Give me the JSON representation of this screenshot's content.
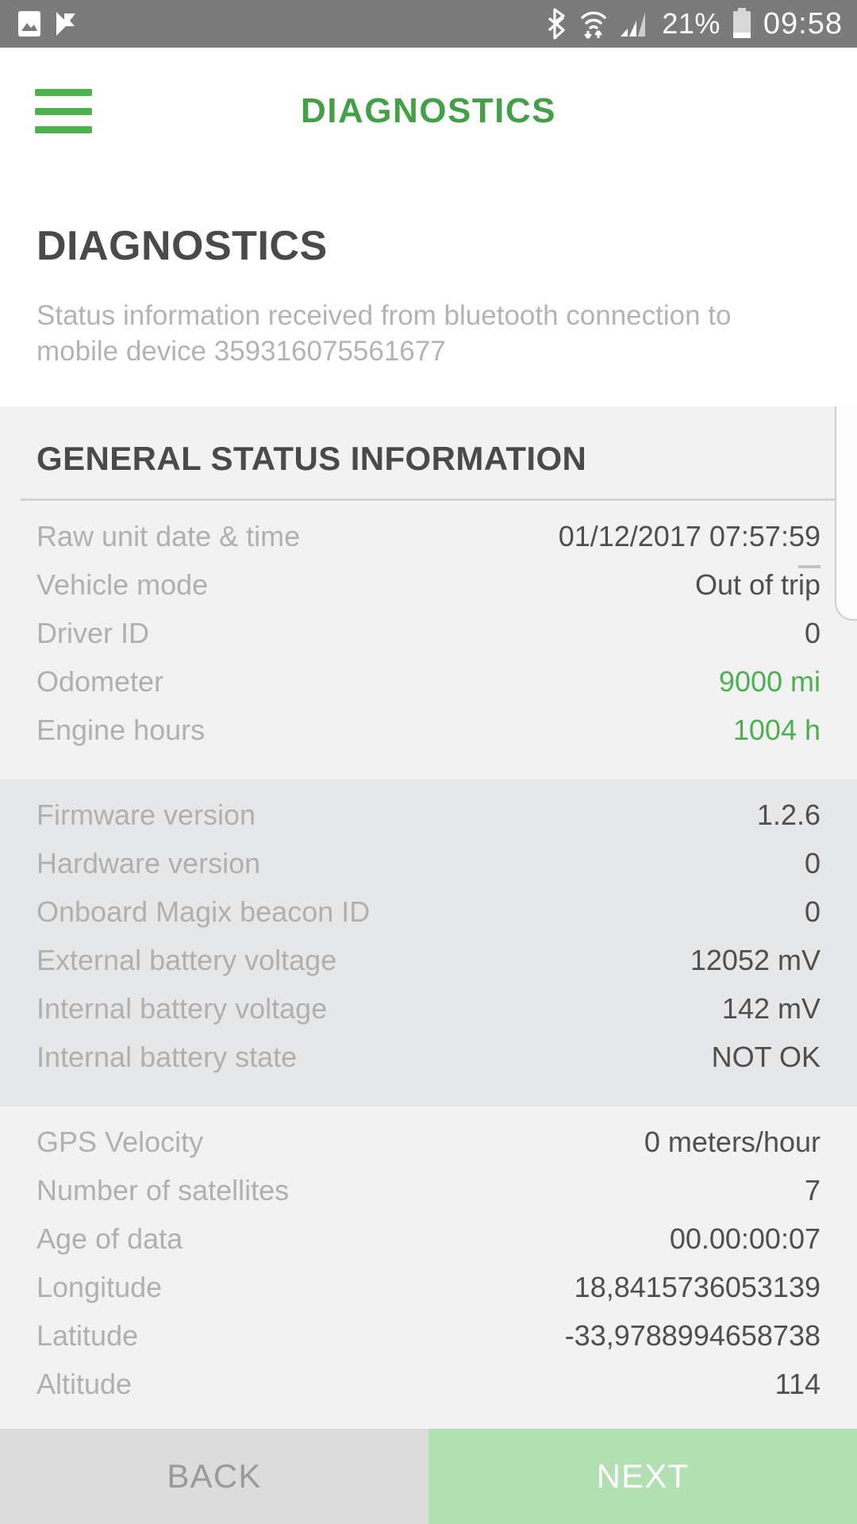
{
  "statusbar": {
    "left_icons": [
      "image-icon",
      "flag-check-icon"
    ],
    "right_icons": [
      "bluetooth-icon",
      "wifi-icon",
      "cellular-signal-icon",
      "battery-icon"
    ],
    "battery_percent": "21%",
    "clock": "09:58"
  },
  "appbar": {
    "menu_icon": "hamburger-menu-icon",
    "title": "DIAGNOSTICS"
  },
  "page": {
    "title": "DIAGNOSTICS",
    "subtitle": "Status information received from bluetooth connection to mobile device 359316075561677"
  },
  "section": {
    "title": "GENERAL STATUS INFORMATION"
  },
  "groups": [
    {
      "shade": "a",
      "rows": [
        {
          "label": "Raw unit date & time",
          "value": "01/12/2017 07:57:59",
          "accent": false
        },
        {
          "label": "Vehicle mode",
          "value": "Out of trip",
          "accent": false
        },
        {
          "label": "Driver ID",
          "value": "0",
          "accent": false
        },
        {
          "label": "Odometer",
          "value": "9000 mi",
          "accent": true
        },
        {
          "label": "Engine hours",
          "value": "1004 h",
          "accent": true
        }
      ]
    },
    {
      "shade": "b",
      "rows": [
        {
          "label": "Firmware version",
          "value": "1.2.6",
          "accent": false
        },
        {
          "label": "Hardware version",
          "value": "0",
          "accent": false
        },
        {
          "label": "Onboard Magix beacon ID",
          "value": "0",
          "accent": false
        },
        {
          "label": "External battery voltage",
          "value": "12052 mV",
          "accent": false
        },
        {
          "label": "Internal battery voltage",
          "value": "142 mV",
          "accent": false
        },
        {
          "label": "Internal battery state",
          "value": "NOT OK",
          "accent": false
        }
      ]
    },
    {
      "shade": "a",
      "rows": [
        {
          "label": "GPS Velocity",
          "value": "0 meters/hour",
          "accent": false
        },
        {
          "label": "Number of satellites",
          "value": "7",
          "accent": false
        },
        {
          "label": "Age of data",
          "value": "00.00:00:07",
          "accent": false
        },
        {
          "label": "Longitude",
          "value": "18,8415736053139",
          "accent": false
        },
        {
          "label": "Latitude",
          "value": "-33,9788994658738",
          "accent": false
        },
        {
          "label": "Altitude",
          "value": "114",
          "accent": false
        }
      ]
    }
  ],
  "actions": {
    "back_label": "BACK",
    "next_label": "NEXT"
  },
  "colors": {
    "brand_green": "#43a047",
    "accent_green": "#4caf50",
    "next_button": "#b2e0b2",
    "statusbar": "#7b7b7b"
  }
}
